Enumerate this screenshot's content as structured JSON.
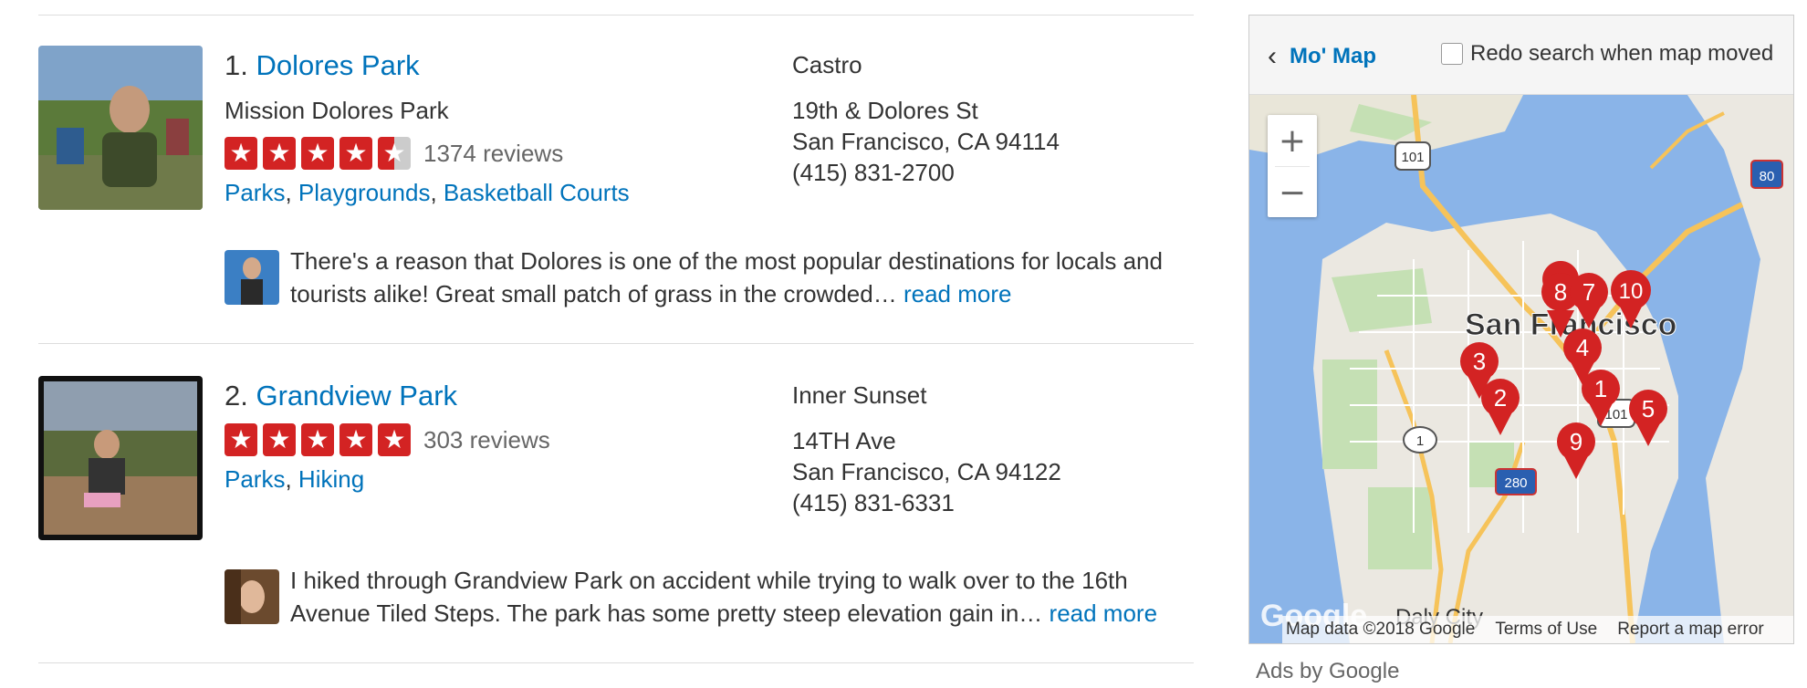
{
  "results": [
    {
      "number": "1.",
      "name": "Dolores Park",
      "subtitle": "Mission Dolores Park",
      "rating": 4.5,
      "reviews": "1374 reviews",
      "categories": [
        "Parks",
        "Playgrounds",
        "Basketball Courts"
      ],
      "neighborhood": "Castro",
      "street": "19th & Dolores St",
      "city": "San Francisco, CA 94114",
      "phone": "(415) 831-2700",
      "snippet": "There's a reason that Dolores is one of the most popular destinations for locals and tourists alike! Great small patch of grass in the crowded…",
      "read_more": "read more"
    },
    {
      "number": "2.",
      "name": "Grandview Park",
      "subtitle": "",
      "rating": 5,
      "reviews": "303 reviews",
      "categories": [
        "Parks",
        "Hiking"
      ],
      "neighborhood": "Inner Sunset",
      "street": "14TH Ave",
      "city": "San Francisco, CA 94122",
      "phone": "(415) 831-6331",
      "snippet": "I hiked through Grandview Park on accident while trying to walk over to the 16th Avenue Tiled Steps. The park has some pretty steep elevation gain in…",
      "read_more": "read more"
    }
  ],
  "map": {
    "header_link": "Mo' Map",
    "redo_label": "Redo search when map moved",
    "city_label": "San Francisco",
    "daly_city": "Daly City",
    "google_logo": "Google",
    "footer": [
      "Map data ©2018 Google",
      "Terms of Use",
      "Report a map error"
    ],
    "zoom_in": "+",
    "zoom_out": "−",
    "markers": [
      "1",
      "2",
      "3",
      "4",
      "5",
      "7",
      "8",
      "9",
      "10"
    ],
    "highway_shields": [
      "101",
      "80",
      "1",
      "101",
      "280"
    ]
  },
  "ads_label": "Ads by Google",
  "colors": {
    "link": "#0073bb",
    "star": "#d32323",
    "marker": "#d32323"
  }
}
